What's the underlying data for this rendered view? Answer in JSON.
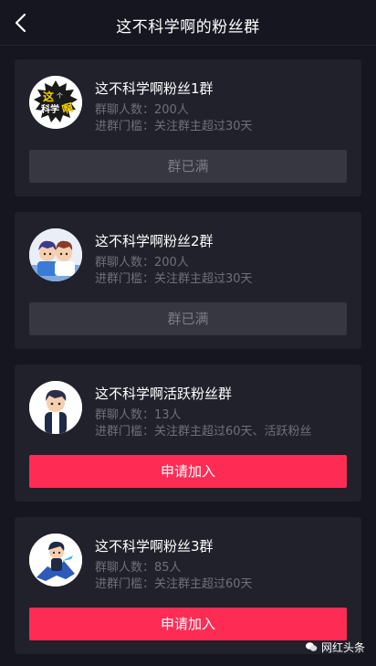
{
  "header": {
    "title": "这不科学啊的粉丝群"
  },
  "groups": [
    {
      "name": "这不科学啊粉丝1群",
      "members_label": "群聊人数：",
      "members": "200人",
      "threshold_label": "进群门槛：",
      "threshold": "关注群主超过30天",
      "button": "群已满",
      "full": true,
      "avatar_icon": "logo-badge-avatar"
    },
    {
      "name": "这不科学啊粉丝2群",
      "members_label": "群聊人数：",
      "members": "200人",
      "threshold_label": "进群门槛：",
      "threshold": "关注群主超过30天",
      "button": "群已满",
      "full": true,
      "avatar_icon": "cartoon-duo-avatar"
    },
    {
      "name": "这不科学啊活跃粉丝群",
      "members_label": "群聊人数：",
      "members": "13人",
      "threshold_label": "进群门槛：",
      "threshold": "关注群主超过60天、活跃粉丝",
      "button": "申请加入",
      "full": false,
      "avatar_icon": "cartoon-boy-avatar"
    },
    {
      "name": "这不科学啊粉丝3群",
      "members_label": "群聊人数：",
      "members": "85人",
      "threshold_label": "进群门槛：",
      "threshold": "关注群主超过60天",
      "button": "申请加入",
      "full": false,
      "avatar_icon": "cartoon-hero-avatar"
    }
  ],
  "logo_text": {
    "top": "这",
    "mid": "个",
    "bottom": "科学",
    "side": "啊"
  },
  "watermark": {
    "text": "网红头条"
  },
  "colors": {
    "background": "#15161f",
    "card": "#20212b",
    "accent": "#fe2c55",
    "button_disabled": "#363741",
    "muted_text": "#6f7079"
  }
}
